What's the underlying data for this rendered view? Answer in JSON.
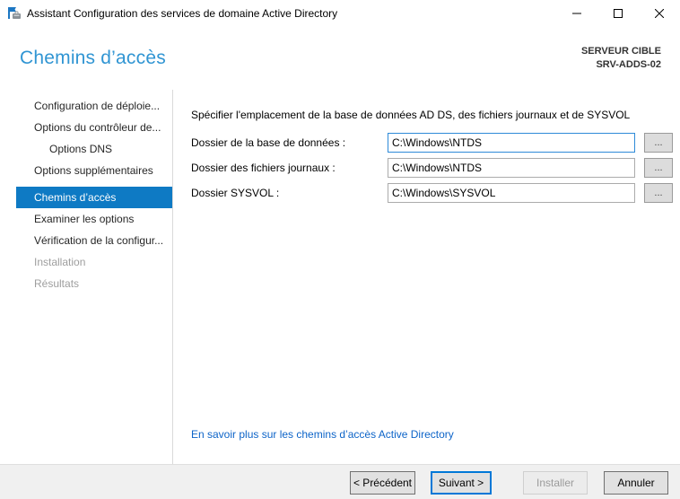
{
  "window": {
    "title": "Assistant Configuration des services de domaine Active Directory"
  },
  "header": {
    "title": "Chemins d’accès",
    "target_server_label": "SERVEUR CIBLE",
    "target_server_name": "SRV-ADDS-02"
  },
  "sidebar": {
    "items": [
      {
        "label": "Configuration de déploie...",
        "state": "normal",
        "indent": 0
      },
      {
        "label": "Options du contrôleur de...",
        "state": "normal",
        "indent": 0
      },
      {
        "label": "Options DNS",
        "state": "normal",
        "indent": 1
      },
      {
        "label": "Options supplémentaires",
        "state": "normal",
        "indent": 0
      },
      {
        "label": "Chemins d’accès",
        "state": "selected",
        "indent": 0
      },
      {
        "label": "Examiner les options",
        "state": "normal",
        "indent": 0
      },
      {
        "label": "Vérification de la configur...",
        "state": "normal",
        "indent": 0
      },
      {
        "label": "Installation",
        "state": "disabled",
        "indent": 0
      },
      {
        "label": "Résultats",
        "state": "disabled",
        "indent": 0
      }
    ]
  },
  "main": {
    "description": "Spécifier l'emplacement de la base de données AD DS, des fichiers journaux et de SYSVOL",
    "fields": [
      {
        "label": "Dossier de la base de données :",
        "value": "C:\\Windows\\NTDS",
        "focused": true
      },
      {
        "label": "Dossier des fichiers journaux :",
        "value": "C:\\Windows\\NTDS",
        "focused": false
      },
      {
        "label": "Dossier SYSVOL :",
        "value": "C:\\Windows\\SYSVOL",
        "focused": false
      }
    ],
    "browse_label": "...",
    "link": "En savoir plus sur les chemins d’accès Active Directory"
  },
  "footer": {
    "buttons": [
      {
        "label": "< Précédent",
        "state": "normal"
      },
      {
        "label": "Suivant >",
        "state": "default"
      },
      {
        "label": "Installer",
        "state": "disabled"
      },
      {
        "label": "Annuler",
        "state": "normal"
      }
    ]
  },
  "colors": {
    "accent": "#0e7ac4",
    "header_title": "#3095d3",
    "link": "#0d64c8",
    "focus_border": "#0078d7"
  }
}
